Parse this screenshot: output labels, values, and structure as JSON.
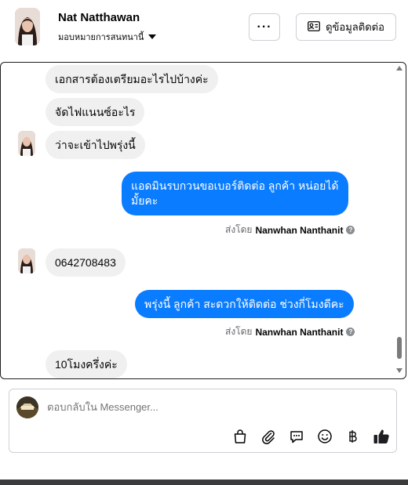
{
  "header": {
    "name": "Nat Natthawan",
    "assign_label": "มอบหมายการสนทนานี้",
    "more_label": "···",
    "contact_button_label": "ดูข้อมูลติดต่อ"
  },
  "messages": [
    {
      "dir": "in",
      "text": "เอกสารต้องเตรียมอะไรไปบ้างค่ะ"
    },
    {
      "dir": "in",
      "text": "จัดไฟแนนซ์อะไร"
    },
    {
      "dir": "in",
      "text": "ว่าจะเข้าไปพรุ่งนี้"
    },
    {
      "dir": "out",
      "lines": [
        "แอดมินรบกวนขอเบอร์ติดต่อ ลูกค้า   หน่อยได้",
        "มั้ยคะ"
      ]
    },
    {
      "dir": "in",
      "text": "0642708483"
    },
    {
      "dir": "out",
      "text": "พรุ่งนี้ ลูกค้า  สะดวกให้ติดต่อ ช่วงกี่โมงดีคะ"
    },
    {
      "dir": "in",
      "text": "10โมงครึ่งค่ะ"
    }
  ],
  "sent_by": {
    "prefix": "ส่งโดย",
    "sender": "Nanwhan Nanthanit",
    "info": "?"
  },
  "composer": {
    "placeholder": "ตอบกลับใน Messenger..."
  },
  "colors": {
    "outgoing_bubble": "#0a7cff",
    "incoming_bubble": "#f0f0f0",
    "like_icon": "#1c1e21"
  },
  "icons": [
    "ellipsis-icon",
    "contact-card-icon",
    "caret-down-icon",
    "shopping-bag-icon",
    "paperclip-icon",
    "saved-replies-icon",
    "emoji-icon",
    "baht-icon",
    "thumbs-up-icon"
  ]
}
